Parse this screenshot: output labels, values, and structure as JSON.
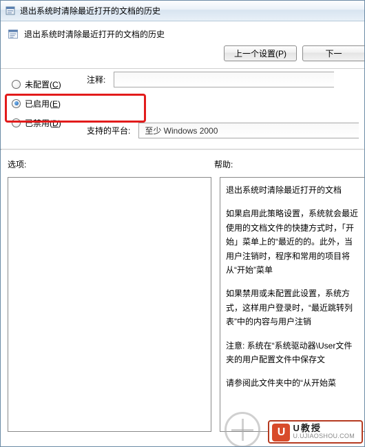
{
  "window": {
    "title": "退出系统时清除最近打开的文档的历史"
  },
  "header": {
    "title": "退出系统时清除最近打开的文档的历史"
  },
  "nav": {
    "prev_label": "上一个设置(P)",
    "next_label": "下一"
  },
  "config": {
    "options": [
      {
        "label": "未配置",
        "accesskey": "C",
        "checked": false
      },
      {
        "label": "已启用",
        "accesskey": "E",
        "checked": true
      },
      {
        "label": "已禁用",
        "accesskey": "D",
        "checked": false
      }
    ],
    "comment_label": "注释:",
    "comment_value": "",
    "platform_label": "支持的平台:",
    "platform_value": "至少 Windows 2000"
  },
  "labels": {
    "options": "选项:",
    "help": "帮助:"
  },
  "help": {
    "paragraphs": [
      "退出系统时清除最近打开的文档",
      "如果启用此策略设置，系统就会最近使用的文档文件的快捷方式时，「开始」菜单上的“最近的的。此外，当用户注销时，程序和常用的项目将从“开始”菜单",
      "如果禁用或未配置此设置，系统方式，这样用户登录时，“最近跳转列表”中的内容与用户注销",
      "注意: 系统在“系统驱动器\\User文件夹的用户配置文件中保存文",
      "请参阅此文件夹中的“从开始菜"
    ]
  },
  "watermark": {
    "brand": "U教授",
    "url": "U.UJIAOSHOU.COM"
  }
}
